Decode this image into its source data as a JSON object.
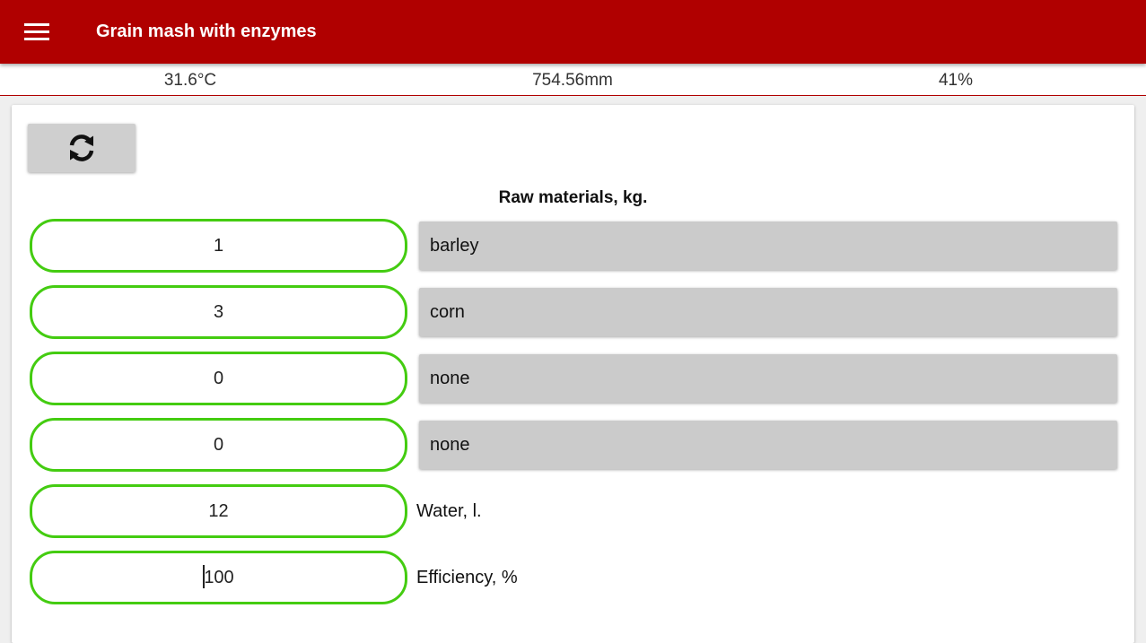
{
  "appbar": {
    "title": "Grain mash with enzymes",
    "menu_icon": "hamburger-menu-icon"
  },
  "status": {
    "temperature": "31.6°C",
    "pressure": "754.56mm",
    "humidity": "41%"
  },
  "card": {
    "refresh_icon": "refresh-icon",
    "section_title": "Raw materials, kg.",
    "materials": [
      {
        "qty": "1",
        "name": "barley"
      },
      {
        "qty": "3",
        "name": "corn"
      },
      {
        "qty": "0",
        "name": "none"
      },
      {
        "qty": "0",
        "name": "none"
      }
    ],
    "water": {
      "value": "12",
      "label": "Water, l."
    },
    "efficiency": {
      "value": "100",
      "label": "Efficiency, %"
    }
  },
  "colors": {
    "appbar": "#b00000",
    "field_border": "#44cc11",
    "select_bg": "#cbcbcb"
  }
}
